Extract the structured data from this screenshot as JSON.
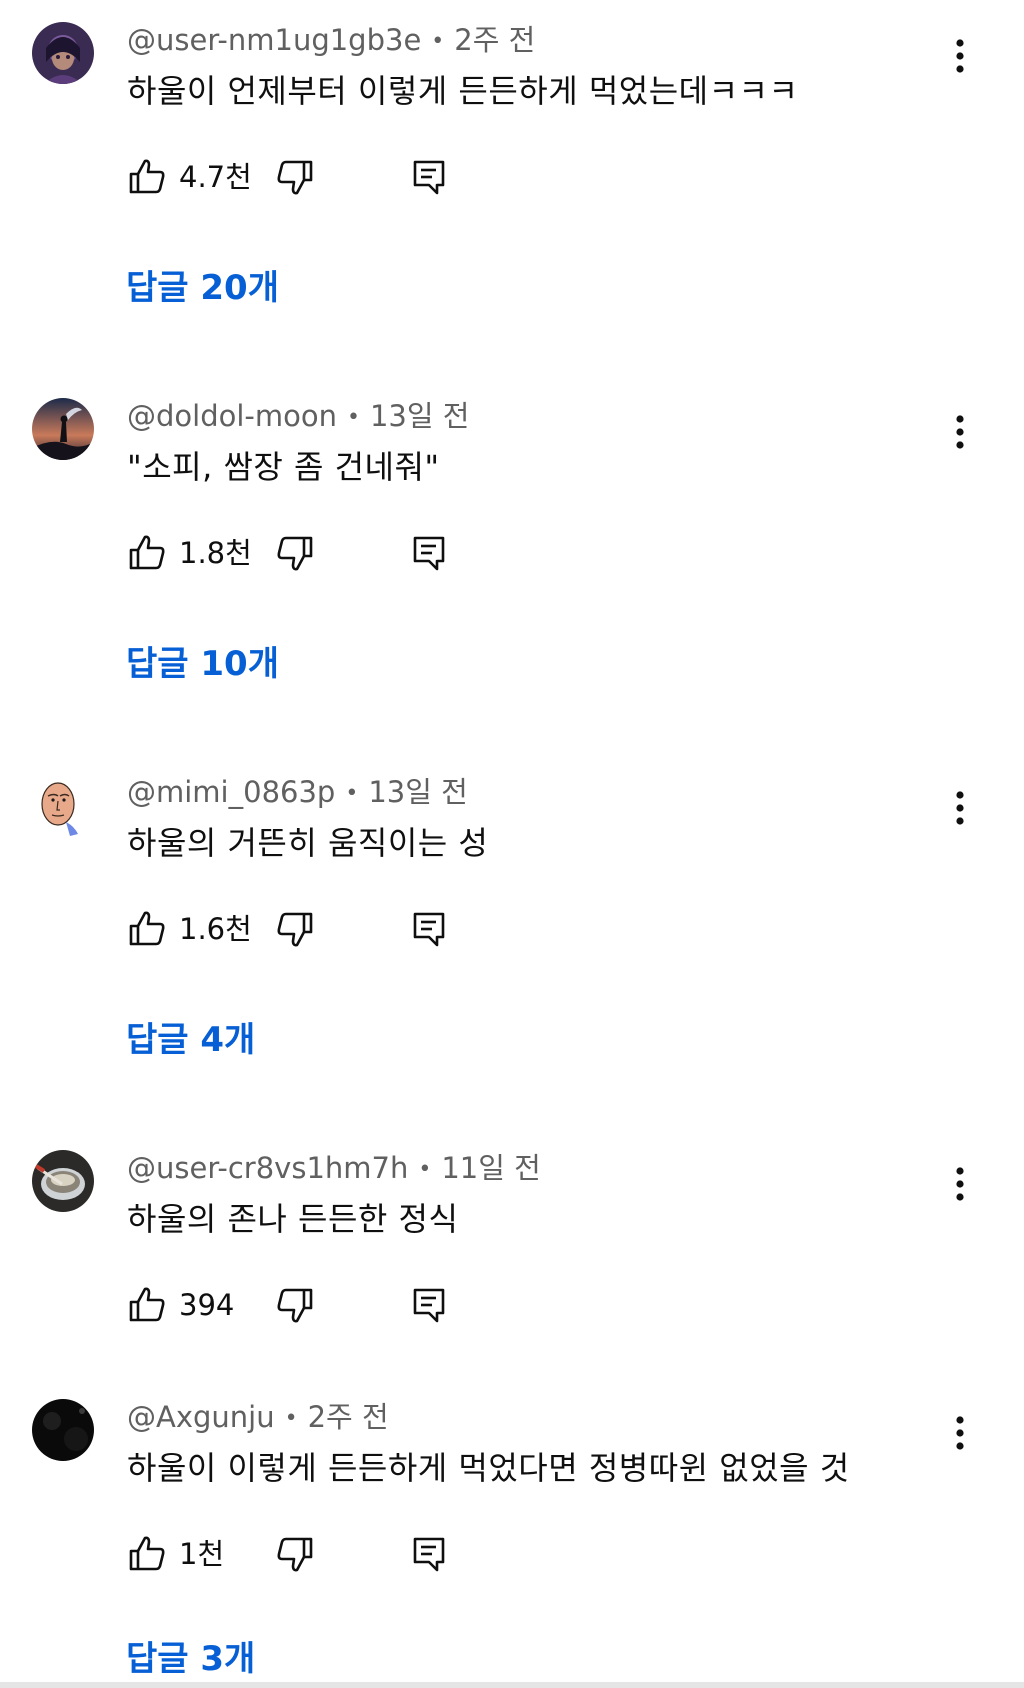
{
  "comments": [
    {
      "author": "@user-nm1ug1gb3e",
      "time": "2주 전",
      "text": "하울이 언제부터 이렇게 든든하게 먹었는데ㅋㅋㅋ",
      "likes": "4.7천",
      "replies": "답글 20개"
    },
    {
      "author": "@doldol-moon",
      "time": "13일 전",
      "text": "\"소피, 쌈장 좀 건네줘\"",
      "likes": "1.8천",
      "replies": "답글 10개"
    },
    {
      "author": "@mimi_0863p",
      "time": "13일 전",
      "text": "하울의 거뜬히 움직이는 성",
      "likes": "1.6천",
      "replies": "답글 4개"
    },
    {
      "author": "@user-cr8vs1hm7h",
      "time": "11일 전",
      "text": "하울의 존나 든든한 정식",
      "likes": "394",
      "replies": ""
    },
    {
      "author": "@Axgunju",
      "time": "2주 전",
      "text": "하울이 이렇게 든든하게 먹었다면 정병따윈 없었을 것",
      "likes": "1천",
      "replies": "답글 3개"
    }
  ],
  "separator": "•",
  "colors": {
    "text": "#0f0f0f",
    "meta": "#606060",
    "link": "#065fd4"
  },
  "icons": {
    "like": "thumbs-up-icon",
    "dislike": "thumbs-down-icon",
    "reply": "reply-comment-icon",
    "menu": "more-vertical-icon"
  }
}
